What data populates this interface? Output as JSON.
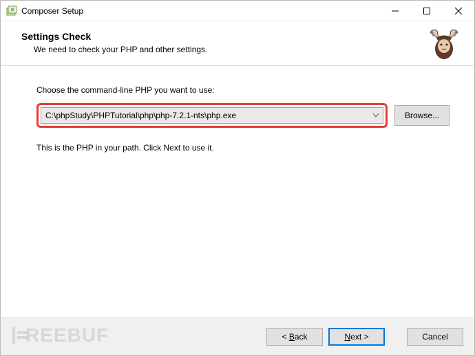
{
  "titlebar": {
    "title": "Composer Setup"
  },
  "header": {
    "title": "Settings Check",
    "subtitle": "We need to check your PHP and other settings."
  },
  "content": {
    "instruction": "Choose the command-line PHP you want to use:",
    "php_path": "C:\\phpStudy\\PHPTutorial\\php\\php-7.2.1-nts\\php.exe",
    "browse_label": "Browse...",
    "path_info": "This is the PHP in your path. Click Next to use it."
  },
  "footer": {
    "back_prefix": "< ",
    "back_ul": "B",
    "back_rest": "ack",
    "next_ul": "N",
    "next_rest": "ext >",
    "cancel": "Cancel"
  },
  "watermark": "REEBUF"
}
